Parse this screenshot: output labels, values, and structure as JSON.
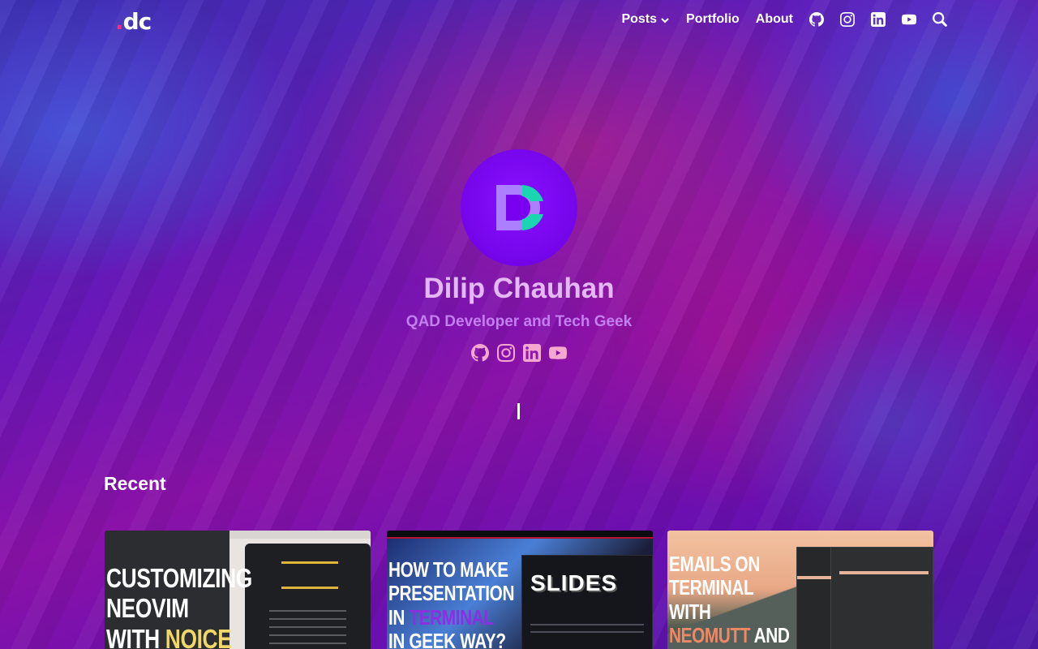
{
  "nav": {
    "logo_dot": ".",
    "logo_text": "dc",
    "posts_label": "Posts",
    "portfolio_label": "Portfolio",
    "about_label": "About",
    "icons": [
      "github-icon",
      "instagram-icon",
      "linkedin-icon",
      "youtube-icon",
      "search-icon"
    ]
  },
  "hero": {
    "name": "Dilip Chauhan",
    "tagline": "QAD Developer and Tech Geek",
    "social_icons": [
      "github-icon",
      "instagram-icon",
      "linkedin-icon",
      "youtube-icon"
    ]
  },
  "recent": {
    "title": "Recent",
    "cards": [
      {
        "lines": [
          "CUSTOMIZING",
          "NEOVIM",
          "WITH"
        ],
        "highlight": "NOICE"
      },
      {
        "lines": [
          "HOW TO MAKE",
          "PRESENTATION",
          "IN"
        ],
        "highlight": "TERMINAL",
        "last": "IN GEEK WAY?",
        "inner_text": "SLIDES"
      },
      {
        "lines": [
          "EMAILS ON",
          "TERMINAL",
          "WITH"
        ],
        "highlight": "NEOMUTT",
        "tail": "AND"
      }
    ]
  },
  "colors": {
    "accent_pink": "#ff2d78",
    "name_color": "#e4b8f6",
    "tagline_color": "#c47ef0",
    "avatar_purple": "#7a00f0"
  }
}
